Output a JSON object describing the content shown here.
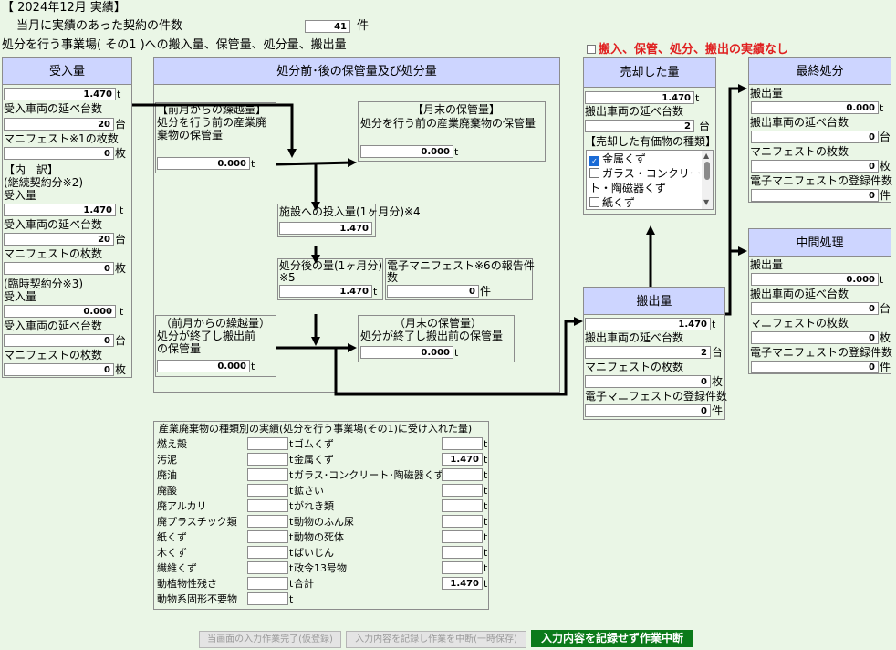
{
  "header": {
    "period": "【 2024年12月 実績】",
    "contract_label": "当月に実績のあった契約の件数",
    "contract_count": "41",
    "contract_unit": "件",
    "facility_title": "処分を行う事業場( その1 )への搬入量、保管量、処分量、搬出量",
    "no_record_label": "搬入、保管、処分、搬出の実績なし"
  },
  "receive": {
    "title": "受入量",
    "amount": "1.470",
    "t": "t",
    "vehicles_label": "受入車両の延べ台数",
    "vehicles": "20",
    "vehicles_unit": "台",
    "manifest_label": "マニフェスト※1の枚数",
    "manifest": "0",
    "manifest_unit": "枚",
    "breakdown_label": "【内　訳】",
    "continuous_label": "(継続契約分※2)",
    "cont_amount_label": "受入量",
    "cont_amount": "1.470",
    "cont_vehicles_label": "受入車両の延べ台数",
    "cont_vehicles": "20",
    "cont_manifest_label": "マニフェストの枚数",
    "cont_manifest": "0",
    "temporary_label": "(臨時契約分※3)",
    "temp_amount_label": "受入量",
    "temp_amount": "0.000",
    "temp_vehicles_label": "受入車両の延べ台数",
    "temp_vehicles": "0",
    "temp_manifest_label": "マニフェストの枚数",
    "temp_manifest": "0"
  },
  "storage": {
    "title": "処分前･後の保管量及び処分量",
    "carry_before_l1": "【前月からの繰越量】",
    "carry_before_l2": "処分を行う前の産業廃",
    "carry_before_l3": "棄物の保管量",
    "carry_before": "0.000",
    "end_before_l1": "【月末の保管量】",
    "end_before_l2": "処分を行う前の産業廃棄物の保管量",
    "end_before": "0.000",
    "input_label": "施設への投入量(1ヶ月分)※4",
    "input": "1.470",
    "after_label_l1": "処分後の量(1ヶ月分)",
    "after_label_l2": "※5",
    "after": "1.470",
    "emanifest_report_l1": "電子マニフェスト※6の報告件",
    "emanifest_report_l2": "数",
    "emanifest_report": "0",
    "emanifest_unit": "件",
    "carry_after_l1": "（前月からの繰越量）",
    "carry_after_l2": "処分が終了し搬出前",
    "carry_after_l3": "の保管量",
    "carry_after": "0.000",
    "end_after_l1": "（月末の保管量）",
    "end_after_l2": "処分が終了し搬出前の保管量",
    "end_after": "0.000"
  },
  "sold": {
    "title": "売却した量",
    "amount": "1.470",
    "vehicles_label": "搬出車両の延べ台数",
    "vehicles": "2",
    "vehicles_unit": "台",
    "kinds_label": "【売却した有価物の種類】",
    "items": [
      {
        "label": "金属くず",
        "checked": true
      },
      {
        "label": "ガラス・コンクリー",
        "checked": false
      },
      {
        "label": "ト・陶磁器くず",
        "checked": null
      },
      {
        "label": "紙くず",
        "checked": false
      }
    ]
  },
  "outflow": {
    "title": "搬出量",
    "amount": "1.470",
    "vehicles_label": "搬出車両の延べ台数",
    "vehicles": "2",
    "manifest_label": "マニフェストの枚数",
    "manifest": "0",
    "emanifest_label": "電子マニフェストの登録件数",
    "emanifest": "0"
  },
  "final": {
    "title": "最終処分",
    "amount_label": "搬出量",
    "amount": "0.000",
    "vehicles_label": "搬出車両の延べ台数",
    "vehicles": "0",
    "manifest_label": "マニフェストの枚数",
    "manifest": "0",
    "emanifest_label": "電子マニフェストの登録件数",
    "emanifest": "0"
  },
  "intermediate": {
    "title": "中間処理",
    "amount_label": "搬出量",
    "amount": "0.000",
    "vehicles_label": "搬出車両の延べ台数",
    "vehicles": "0",
    "manifest_label": "マニフェストの枚数",
    "manifest": "0",
    "emanifest_label": "電子マニフェストの登録件数",
    "emanifest": "0"
  },
  "units": {
    "t": "t",
    "dai": "台",
    "mai": "枚",
    "ken": "件"
  },
  "waste_table": {
    "title": "産業廃棄物の種類別の実績(処分を行う事業場(その1)に受け入れた量)",
    "left": [
      {
        "name": "燃え殻",
        "value": ""
      },
      {
        "name": "汚泥",
        "value": ""
      },
      {
        "name": "廃油",
        "value": ""
      },
      {
        "name": "廃酸",
        "value": ""
      },
      {
        "name": "廃アルカリ",
        "value": ""
      },
      {
        "name": "廃プラスチック類",
        "value": ""
      },
      {
        "name": "紙くず",
        "value": ""
      },
      {
        "name": "木くず",
        "value": ""
      },
      {
        "name": "繊維くず",
        "value": ""
      },
      {
        "name": "動植物性残さ",
        "value": ""
      },
      {
        "name": "動物系固形不要物",
        "value": ""
      }
    ],
    "right": [
      {
        "name": "ゴムくず",
        "value": ""
      },
      {
        "name": "金属くず",
        "value": "1.470"
      },
      {
        "name": "ガラス･コンクリート･陶磁器くず",
        "value": ""
      },
      {
        "name": "鉱さい",
        "value": ""
      },
      {
        "name": "がれき類",
        "value": ""
      },
      {
        "name": "動物のふん尿",
        "value": ""
      },
      {
        "name": "動物の死体",
        "value": ""
      },
      {
        "name": "ばいじん",
        "value": ""
      },
      {
        "name": "政令13号物",
        "value": ""
      },
      {
        "name": "合計",
        "value": "1.470"
      }
    ]
  },
  "buttons": {
    "temp_save": "当画面の入力作業完了(仮登録)",
    "suspend_save": "入力内容を記録し作業を中断(一時保存)",
    "abort": "入力内容を記録せず作業中断"
  },
  "colors": {
    "header_bg": "#cdd5ff",
    "page_bg": "#eaf6e6",
    "alert": "#e02020",
    "button_green": "#0b7a1a"
  }
}
